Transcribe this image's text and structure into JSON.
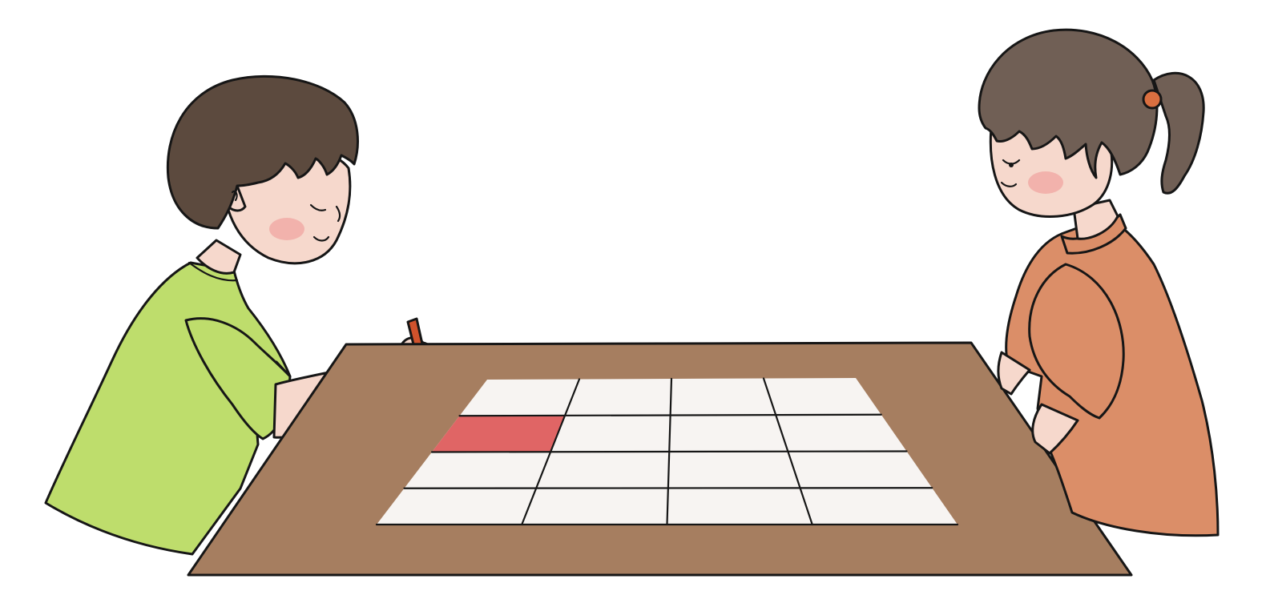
{
  "scene": {
    "colors": {
      "background": "#ffffff",
      "table": "#a67e60",
      "paper": "#f7f4f2",
      "shaded_cell": "#e06565",
      "boy_shirt": "#bedd6c",
      "boy_hair": "#5c4a3e",
      "girl_dress": "#db8e68",
      "girl_hair": "#705f55",
      "skin": "#f6d8cc",
      "blush": "#f0a6a2",
      "pencil": "#d0522c",
      "hair_tie": "#d96f40"
    },
    "grid": {
      "rows": 4,
      "columns": 4,
      "shaded_cells": [
        {
          "row": 2,
          "column": 1
        }
      ]
    },
    "characters": [
      {
        "name": "boy",
        "holding": "pencil-icon"
      },
      {
        "name": "girl",
        "holding": ""
      }
    ]
  }
}
